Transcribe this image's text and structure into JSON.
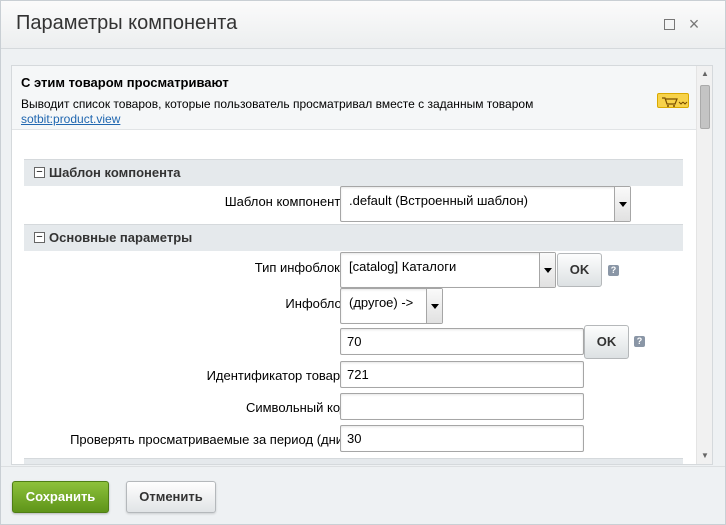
{
  "dialog": {
    "title": "Параметры компонента",
    "minimize_icon": "minimize-icon",
    "close_icon": "close-icon"
  },
  "component": {
    "name": "С этим товаром просматривают",
    "description": "Выводит список товаров, которые пользователь просматривал вместе с заданным товаром",
    "link": "sotbit:product.view",
    "badge_icon": "shopping-cart-icon"
  },
  "sections": {
    "template": {
      "label": "Шаблон компонента",
      "toggle": "−",
      "template_label": "Шаблон компонента:",
      "template_value": ".default (Встроенный шаблон)"
    },
    "main": {
      "label": "Основные параметры",
      "toggle": "−",
      "iblock_type_label": "Тип инфоблока:",
      "iblock_type_value": "[catalog] Каталоги",
      "iblock_label": "Инфоблок:",
      "iblock_value": "(другое) ->",
      "iblock_id_value": "70",
      "product_id_label": "Идентификатор товара:",
      "product_id_value": "721",
      "code_label": "Символьный код:",
      "code_value": "",
      "period_label": "Проверять просматриваемые за период (дни):",
      "period_value": "30",
      "ok_label": "OK",
      "help_label": "?"
    }
  },
  "footer": {
    "save_label": "Сохранить",
    "cancel_label": "Отменить"
  },
  "colors": {
    "save_button": "#6fa52a",
    "link": "#2067b0",
    "section_bg": "#e5e9ec"
  }
}
